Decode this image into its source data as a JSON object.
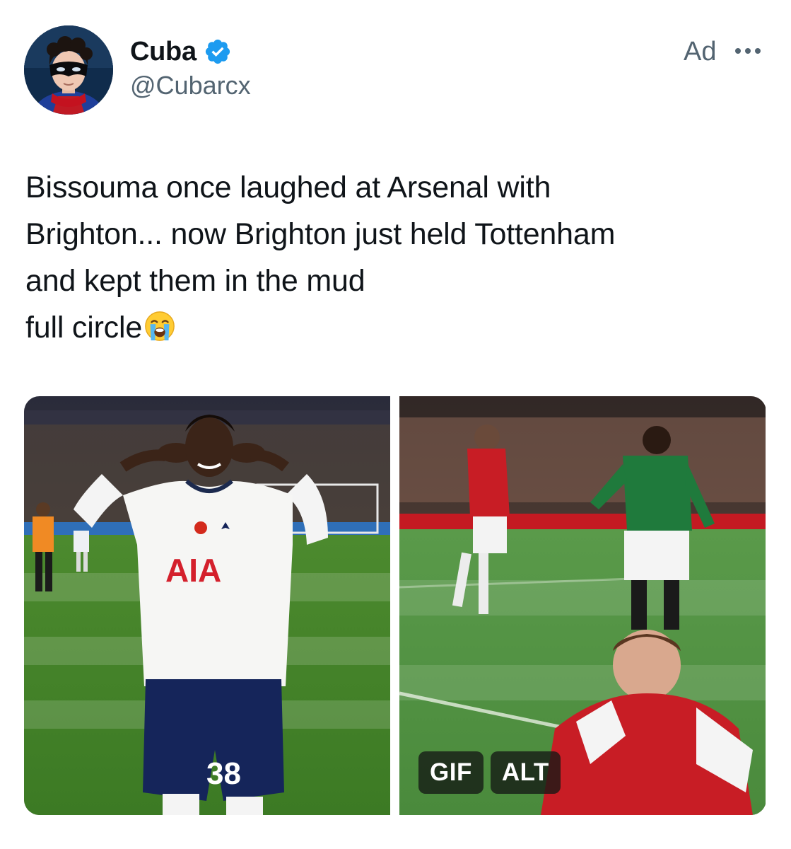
{
  "author": {
    "name": "Cuba",
    "handle": "@Cubarcx",
    "verified_icon": "verified-badge-icon",
    "avatar": "avatar"
  },
  "ad_label": "Ad",
  "more_icon": "more-options-icon",
  "tweet": {
    "lines": [
      "Bissouma once laughed at Arsenal with",
      "Brighton... now Brighton just held Tottenham",
      "and kept them in the mud",
      "full circle"
    ],
    "emoji": "loudly-crying-face-icon"
  },
  "media": {
    "left_image": {
      "jersey_text": "AIA",
      "shorts_number": "38"
    },
    "right_gif": {
      "badges": [
        "GIF",
        "ALT"
      ]
    }
  },
  "colors": {
    "text_primary": "#0f1419",
    "text_secondary": "#536471",
    "verified_blue": "#1d9bf0"
  }
}
